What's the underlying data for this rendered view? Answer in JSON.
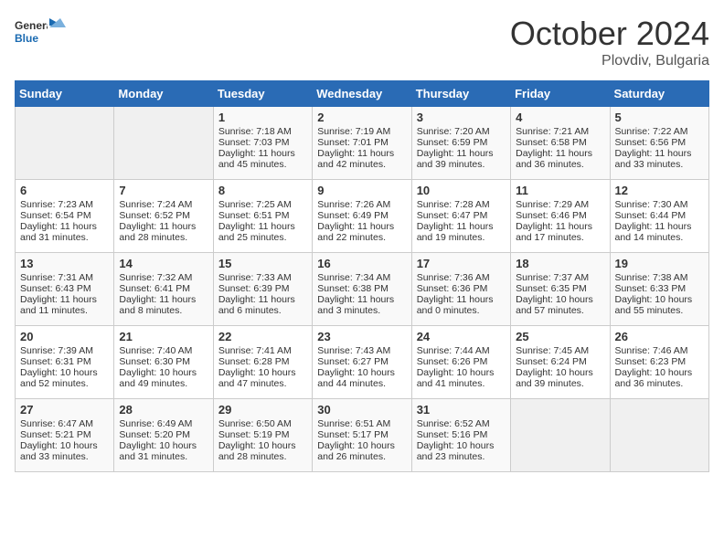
{
  "logo": {
    "general": "General",
    "blue": "Blue"
  },
  "header": {
    "month": "October 2024",
    "location": "Plovdiv, Bulgaria"
  },
  "weekdays": [
    "Sunday",
    "Monday",
    "Tuesday",
    "Wednesday",
    "Thursday",
    "Friday",
    "Saturday"
  ],
  "weeks": [
    [
      {
        "day": "",
        "empty": true
      },
      {
        "day": "",
        "empty": true
      },
      {
        "day": "1",
        "sunrise": "Sunrise: 7:18 AM",
        "sunset": "Sunset: 7:03 PM",
        "daylight": "Daylight: 11 hours and 45 minutes."
      },
      {
        "day": "2",
        "sunrise": "Sunrise: 7:19 AM",
        "sunset": "Sunset: 7:01 PM",
        "daylight": "Daylight: 11 hours and 42 minutes."
      },
      {
        "day": "3",
        "sunrise": "Sunrise: 7:20 AM",
        "sunset": "Sunset: 6:59 PM",
        "daylight": "Daylight: 11 hours and 39 minutes."
      },
      {
        "day": "4",
        "sunrise": "Sunrise: 7:21 AM",
        "sunset": "Sunset: 6:58 PM",
        "daylight": "Daylight: 11 hours and 36 minutes."
      },
      {
        "day": "5",
        "sunrise": "Sunrise: 7:22 AM",
        "sunset": "Sunset: 6:56 PM",
        "daylight": "Daylight: 11 hours and 33 minutes."
      }
    ],
    [
      {
        "day": "6",
        "sunrise": "Sunrise: 7:23 AM",
        "sunset": "Sunset: 6:54 PM",
        "daylight": "Daylight: 11 hours and 31 minutes."
      },
      {
        "day": "7",
        "sunrise": "Sunrise: 7:24 AM",
        "sunset": "Sunset: 6:52 PM",
        "daylight": "Daylight: 11 hours and 28 minutes."
      },
      {
        "day": "8",
        "sunrise": "Sunrise: 7:25 AM",
        "sunset": "Sunset: 6:51 PM",
        "daylight": "Daylight: 11 hours and 25 minutes."
      },
      {
        "day": "9",
        "sunrise": "Sunrise: 7:26 AM",
        "sunset": "Sunset: 6:49 PM",
        "daylight": "Daylight: 11 hours and 22 minutes."
      },
      {
        "day": "10",
        "sunrise": "Sunrise: 7:28 AM",
        "sunset": "Sunset: 6:47 PM",
        "daylight": "Daylight: 11 hours and 19 minutes."
      },
      {
        "day": "11",
        "sunrise": "Sunrise: 7:29 AM",
        "sunset": "Sunset: 6:46 PM",
        "daylight": "Daylight: 11 hours and 17 minutes."
      },
      {
        "day": "12",
        "sunrise": "Sunrise: 7:30 AM",
        "sunset": "Sunset: 6:44 PM",
        "daylight": "Daylight: 11 hours and 14 minutes."
      }
    ],
    [
      {
        "day": "13",
        "sunrise": "Sunrise: 7:31 AM",
        "sunset": "Sunset: 6:43 PM",
        "daylight": "Daylight: 11 hours and 11 minutes."
      },
      {
        "day": "14",
        "sunrise": "Sunrise: 7:32 AM",
        "sunset": "Sunset: 6:41 PM",
        "daylight": "Daylight: 11 hours and 8 minutes."
      },
      {
        "day": "15",
        "sunrise": "Sunrise: 7:33 AM",
        "sunset": "Sunset: 6:39 PM",
        "daylight": "Daylight: 11 hours and 6 minutes."
      },
      {
        "day": "16",
        "sunrise": "Sunrise: 7:34 AM",
        "sunset": "Sunset: 6:38 PM",
        "daylight": "Daylight: 11 hours and 3 minutes."
      },
      {
        "day": "17",
        "sunrise": "Sunrise: 7:36 AM",
        "sunset": "Sunset: 6:36 PM",
        "daylight": "Daylight: 11 hours and 0 minutes."
      },
      {
        "day": "18",
        "sunrise": "Sunrise: 7:37 AM",
        "sunset": "Sunset: 6:35 PM",
        "daylight": "Daylight: 10 hours and 57 minutes."
      },
      {
        "day": "19",
        "sunrise": "Sunrise: 7:38 AM",
        "sunset": "Sunset: 6:33 PM",
        "daylight": "Daylight: 10 hours and 55 minutes."
      }
    ],
    [
      {
        "day": "20",
        "sunrise": "Sunrise: 7:39 AM",
        "sunset": "Sunset: 6:31 PM",
        "daylight": "Daylight: 10 hours and 52 minutes."
      },
      {
        "day": "21",
        "sunrise": "Sunrise: 7:40 AM",
        "sunset": "Sunset: 6:30 PM",
        "daylight": "Daylight: 10 hours and 49 minutes."
      },
      {
        "day": "22",
        "sunrise": "Sunrise: 7:41 AM",
        "sunset": "Sunset: 6:28 PM",
        "daylight": "Daylight: 10 hours and 47 minutes."
      },
      {
        "day": "23",
        "sunrise": "Sunrise: 7:43 AM",
        "sunset": "Sunset: 6:27 PM",
        "daylight": "Daylight: 10 hours and 44 minutes."
      },
      {
        "day": "24",
        "sunrise": "Sunrise: 7:44 AM",
        "sunset": "Sunset: 6:26 PM",
        "daylight": "Daylight: 10 hours and 41 minutes."
      },
      {
        "day": "25",
        "sunrise": "Sunrise: 7:45 AM",
        "sunset": "Sunset: 6:24 PM",
        "daylight": "Daylight: 10 hours and 39 minutes."
      },
      {
        "day": "26",
        "sunrise": "Sunrise: 7:46 AM",
        "sunset": "Sunset: 6:23 PM",
        "daylight": "Daylight: 10 hours and 36 minutes."
      }
    ],
    [
      {
        "day": "27",
        "sunrise": "Sunrise: 6:47 AM",
        "sunset": "Sunset: 5:21 PM",
        "daylight": "Daylight: 10 hours and 33 minutes."
      },
      {
        "day": "28",
        "sunrise": "Sunrise: 6:49 AM",
        "sunset": "Sunset: 5:20 PM",
        "daylight": "Daylight: 10 hours and 31 minutes."
      },
      {
        "day": "29",
        "sunrise": "Sunrise: 6:50 AM",
        "sunset": "Sunset: 5:19 PM",
        "daylight": "Daylight: 10 hours and 28 minutes."
      },
      {
        "day": "30",
        "sunrise": "Sunrise: 6:51 AM",
        "sunset": "Sunset: 5:17 PM",
        "daylight": "Daylight: 10 hours and 26 minutes."
      },
      {
        "day": "31",
        "sunrise": "Sunrise: 6:52 AM",
        "sunset": "Sunset: 5:16 PM",
        "daylight": "Daylight: 10 hours and 23 minutes."
      },
      {
        "day": "",
        "empty": true
      },
      {
        "day": "",
        "empty": true
      }
    ]
  ]
}
